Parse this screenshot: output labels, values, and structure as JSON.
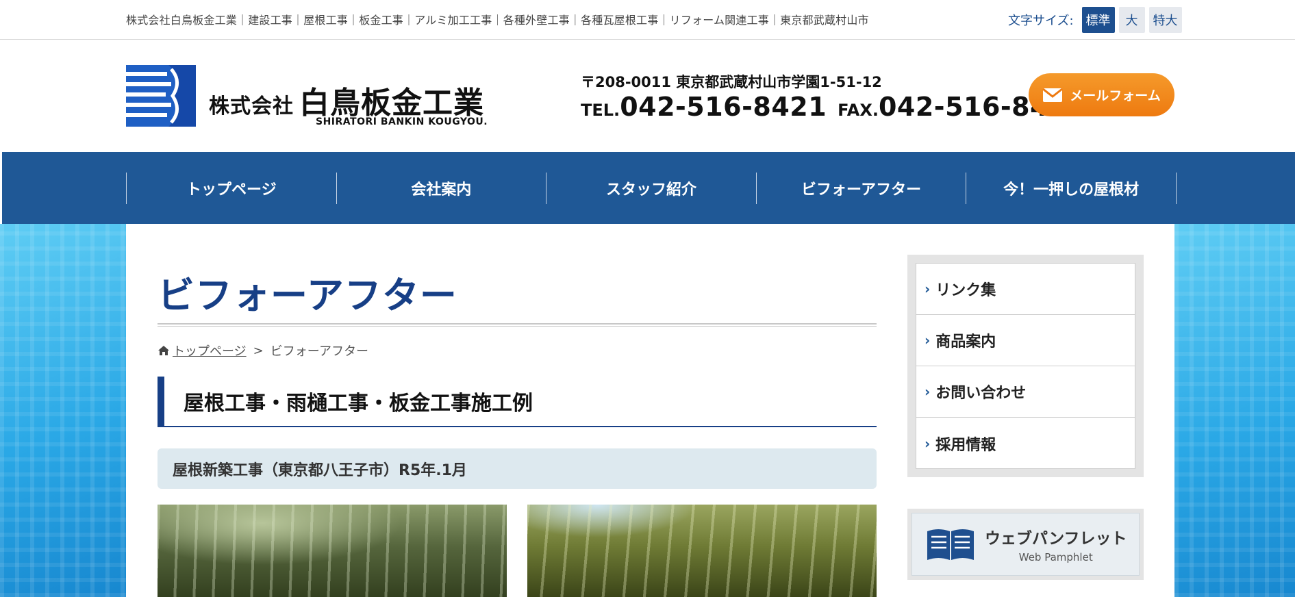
{
  "topbar": {
    "tagline": "株式会社白鳥板金工業｜建設工事｜屋根工事｜板金工事｜アルミ加工工事｜各種外壁工事｜各種瓦屋根工事｜リフォーム関連工事｜東京都武蔵村山市",
    "font_size_label": "文字サイズ:",
    "font_sizes": [
      "標準",
      "大",
      "特大"
    ],
    "active_font_size": "標準"
  },
  "header": {
    "company_kk": "株式会社",
    "company_name": "白鳥板金工業",
    "company_en": "SHIRATORI BANKIN KOUGYOU.",
    "address": "〒208-0011 東京都武蔵村山市学園1-51-12",
    "tel_prefix": "TEL.",
    "tel": "042-516-8421",
    "fax_prefix": "FAX.",
    "fax": "042-516-8422",
    "mail_button": "メールフォーム",
    "brand_color": "#1f5896",
    "accent_color": "#f08a1c"
  },
  "nav": {
    "items": [
      "トップページ",
      "会社案内",
      "スタッフ紹介",
      "ビフォーアフター",
      "今！一押しの屋根材"
    ]
  },
  "main": {
    "page_title": "ビフォーアフター",
    "breadcrumb": {
      "home_icon": "home-icon",
      "home": "トップページ",
      "separator": ">",
      "current": "ビフォーアフター"
    },
    "section_title": "屋根工事・雨樋工事・板金工事施工例",
    "sub_title": "屋根新築工事（東京都八王子市）R5年.1月"
  },
  "sidebar": {
    "items": [
      "リンク集",
      "商品案内",
      "お問い合わせ",
      "採用情報"
    ],
    "pamphlet_title": "ウェブパンフレット",
    "pamphlet_sub": "Web Pamphlet"
  }
}
